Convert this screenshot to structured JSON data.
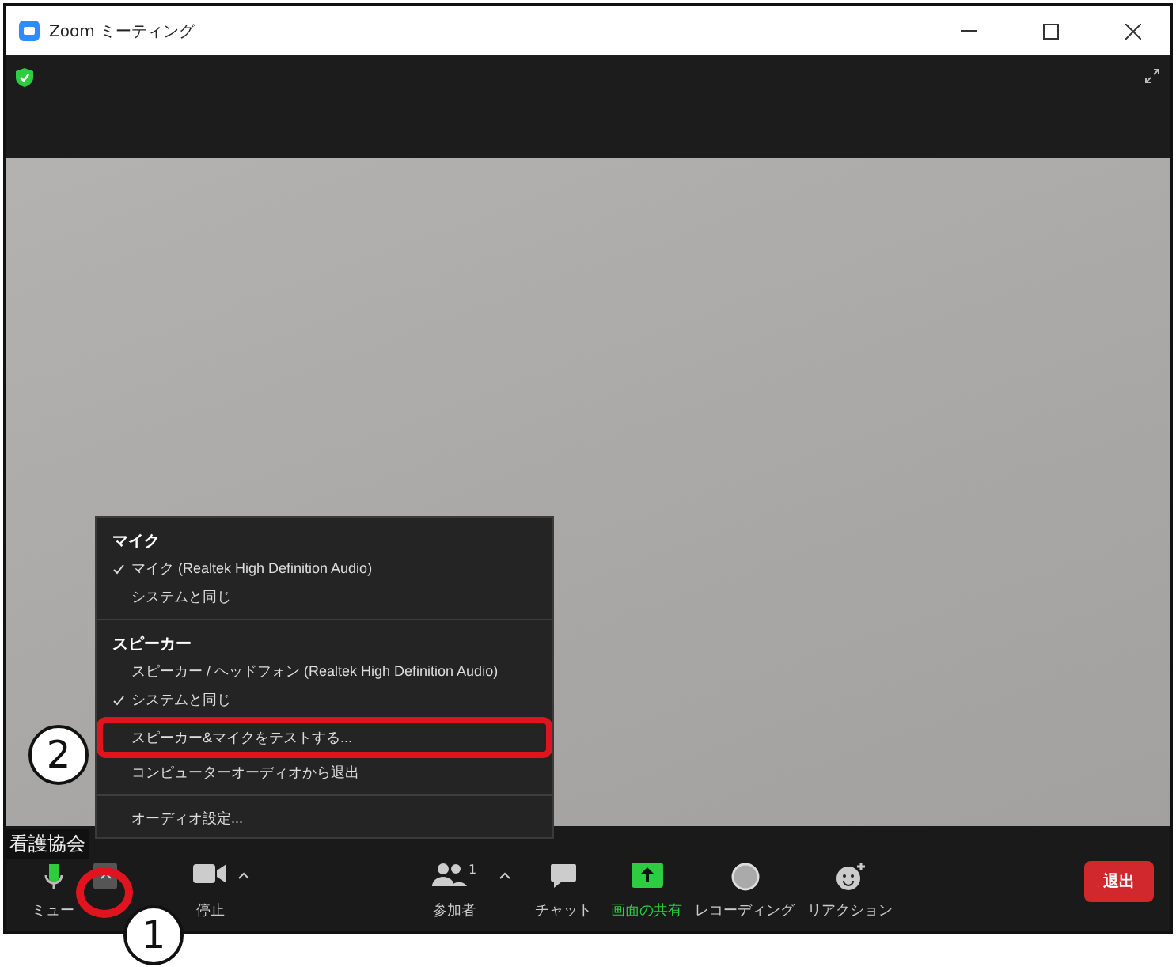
{
  "window": {
    "title": "Zoom ミーティング"
  },
  "participant_name": "看護協会",
  "audio_menu": {
    "items": [
      {
        "kind": "header",
        "label": "マイク"
      },
      {
        "kind": "option",
        "label": "マイク (Realtek High Definition Audio)",
        "checked": true
      },
      {
        "kind": "option",
        "label": "システムと同じ",
        "checked": false
      },
      {
        "kind": "divider"
      },
      {
        "kind": "header",
        "label": "スピーカー"
      },
      {
        "kind": "option",
        "label": "スピーカー / ヘッドフォン (Realtek High Definition Audio)",
        "checked": false
      },
      {
        "kind": "option",
        "label": "システムと同じ",
        "checked": true
      },
      {
        "kind": "action",
        "label": "スピーカー&マイクをテストする...",
        "annotated": true
      },
      {
        "kind": "action",
        "label": "コンピューターオーディオから退出",
        "annotated": false
      },
      {
        "kind": "divider"
      },
      {
        "kind": "action",
        "label": "オーディオ設定...",
        "annotated": false
      }
    ]
  },
  "toolbar": {
    "items": [
      {
        "kind": "mic",
        "label": "ミュー",
        "caret": true,
        "highlighted": false
      },
      {
        "kind": "video",
        "label": "停止",
        "caret": true,
        "highlighted": false
      },
      {
        "kind": "participants",
        "label": "参加者",
        "count": "1",
        "caret": true,
        "highlighted": false
      },
      {
        "kind": "chat",
        "label": "チャット",
        "caret": false,
        "highlighted": false
      },
      {
        "kind": "share",
        "label": "画面の共有",
        "caret": false,
        "highlighted": true
      },
      {
        "kind": "record",
        "label": "レコーディング",
        "caret": false,
        "highlighted": false
      },
      {
        "kind": "reactions",
        "label": "リアクション",
        "caret": false,
        "highlighted": false
      }
    ],
    "leave_button": "退出"
  },
  "annotations": [
    {
      "kind": "step",
      "label": "2"
    },
    {
      "kind": "step",
      "label": "1"
    }
  ]
}
